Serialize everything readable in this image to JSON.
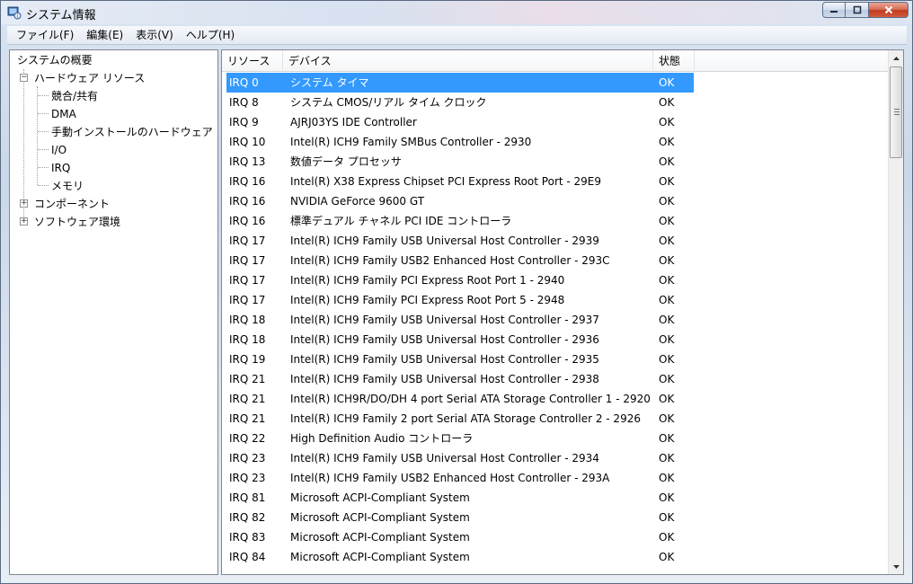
{
  "window": {
    "title": "システム情報"
  },
  "menu": [
    {
      "label": "ファイル(F)",
      "name": "menu-file"
    },
    {
      "label": "編集(E)",
      "name": "menu-edit"
    },
    {
      "label": "表示(V)",
      "name": "menu-view"
    },
    {
      "label": "ヘルプ(H)",
      "name": "menu-help"
    }
  ],
  "tree": {
    "root": "システムの概要",
    "hardware": "ハードウェア リソース",
    "hardware_children": [
      "競合/共有",
      "DMA",
      "手動インストールのハードウェア",
      "I/O",
      "IRQ",
      "メモリ"
    ],
    "components": "コンポーネント",
    "software": "ソフトウェア環境",
    "expander_open": "−",
    "expander_closed": "+"
  },
  "table": {
    "headers": {
      "resource": "リソース",
      "device": "デバイス",
      "status": "状態"
    },
    "rows": [
      {
        "resource": "IRQ 0",
        "device": "システム タイマ",
        "status": "OK"
      },
      {
        "resource": "IRQ 8",
        "device": "システム CMOS/リアル タイム クロック",
        "status": "OK"
      },
      {
        "resource": "IRQ 9",
        "device": "AJRJ03YS IDE Controller",
        "status": "OK"
      },
      {
        "resource": "IRQ 10",
        "device": "Intel(R) ICH9 Family SMBus Controller - 2930",
        "status": "OK"
      },
      {
        "resource": "IRQ 13",
        "device": "数値データ プロセッサ",
        "status": "OK"
      },
      {
        "resource": "IRQ 16",
        "device": "Intel(R) X38 Express Chipset PCI Express Root Port - 29E9",
        "status": "OK"
      },
      {
        "resource": "IRQ 16",
        "device": "NVIDIA GeForce 9600 GT",
        "status": "OK"
      },
      {
        "resource": "IRQ 16",
        "device": "標準デュアル チャネル PCI IDE コントローラ",
        "status": "OK"
      },
      {
        "resource": "IRQ 17",
        "device": "Intel(R) ICH9 Family USB Universal Host Controller - 2939",
        "status": "OK"
      },
      {
        "resource": "IRQ 17",
        "device": "Intel(R) ICH9 Family USB2 Enhanced Host Controller - 293C",
        "status": "OK"
      },
      {
        "resource": "IRQ 17",
        "device": "Intel(R) ICH9 Family PCI Express Root Port 1 - 2940",
        "status": "OK"
      },
      {
        "resource": "IRQ 17",
        "device": "Intel(R) ICH9 Family PCI Express Root Port 5 - 2948",
        "status": "OK"
      },
      {
        "resource": "IRQ 18",
        "device": "Intel(R) ICH9 Family USB Universal Host Controller - 2937",
        "status": "OK"
      },
      {
        "resource": "IRQ 18",
        "device": "Intel(R) ICH9 Family USB Universal Host Controller - 2936",
        "status": "OK"
      },
      {
        "resource": "IRQ 19",
        "device": "Intel(R) ICH9 Family USB Universal Host Controller - 2935",
        "status": "OK"
      },
      {
        "resource": "IRQ 21",
        "device": "Intel(R) ICH9 Family USB Universal Host Controller - 2938",
        "status": "OK"
      },
      {
        "resource": "IRQ 21",
        "device": "Intel(R) ICH9R/DO/DH 4 port Serial ATA Storage Controller 1 - 2920",
        "status": "OK"
      },
      {
        "resource": "IRQ 21",
        "device": "Intel(R) ICH9 Family 2 port Serial ATA Storage Controller 2 - 2926",
        "status": "OK"
      },
      {
        "resource": "IRQ 22",
        "device": "High Definition Audio コントローラ",
        "status": "OK"
      },
      {
        "resource": "IRQ 23",
        "device": "Intel(R) ICH9 Family USB Universal Host Controller - 2934",
        "status": "OK"
      },
      {
        "resource": "IRQ 23",
        "device": "Intel(R) ICH9 Family USB2 Enhanced Host Controller - 293A",
        "status": "OK"
      },
      {
        "resource": "IRQ 81",
        "device": "Microsoft ACPI-Compliant System",
        "status": "OK"
      },
      {
        "resource": "IRQ 82",
        "device": "Microsoft ACPI-Compliant System",
        "status": "OK"
      },
      {
        "resource": "IRQ 83",
        "device": "Microsoft ACPI-Compliant System",
        "status": "OK"
      },
      {
        "resource": "IRQ 84",
        "device": "Microsoft ACPI-Compliant System",
        "status": "OK"
      }
    ]
  },
  "icons": {
    "minimize": "minimize-icon",
    "maximize": "maximize-icon",
    "close": "close-icon",
    "scroll_up": "scroll-up-arrow-icon",
    "scroll_down": "scroll-down-arrow-icon"
  },
  "colors": {
    "selection": "#3399ff",
    "close_button": "#c23a1f"
  }
}
